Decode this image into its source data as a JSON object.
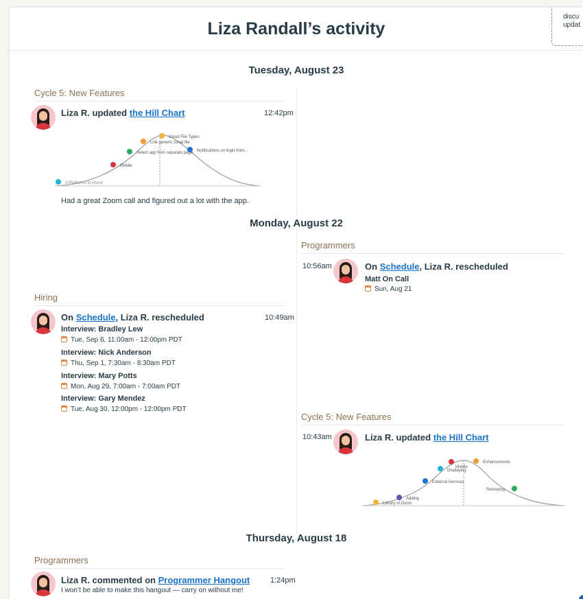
{
  "header": {
    "title": "Liza Randall’s activity"
  },
  "tooltip": {
    "line1": "discu",
    "line2": "updat"
  },
  "days": [
    {
      "label": "Tuesday, August 23"
    },
    {
      "label": "Monday, August 22"
    },
    {
      "label": "Thursday, August 18"
    }
  ],
  "entries": {
    "hill1": {
      "bucket": "Cycle 5: New Features",
      "actor": "Liza R. updated",
      "link": "the Hill Chart",
      "time": "12:42pm",
      "note": "Had a great Zoom call and figured out a lot with the app.",
      "points": [
        {
          "label": "Cloud File Types",
          "color": "#f2b33d"
        },
        {
          "label": "Link generic cloud file",
          "color": "#f29b3a"
        },
        {
          "label": "Select app from separate page",
          "color": "#2aa85b"
        },
        {
          "label": "Notifications on login from...",
          "color": "#1f72d1"
        },
        {
          "label": "Mobile",
          "color": "#d8353b"
        },
        {
          "label": "A Platforms to check",
          "color": "#1fb5d6"
        }
      ]
    },
    "sched1": {
      "bucket": "Programmers",
      "prefix": "On",
      "link": "Schedule",
      "suffix": ", Liza R. rescheduled",
      "time": "10:56am",
      "events": [
        {
          "name": "Matt On Call",
          "when": "Sun, Aug 21"
        }
      ]
    },
    "sched2": {
      "bucket": "Hiring",
      "prefix": "On",
      "link": "Schedule",
      "suffix": ", Liza R. rescheduled",
      "time": "10:49am",
      "events": [
        {
          "name": "Interview: Bradley Lew",
          "when": "Tue, Sep 6, 11:00am - 12:00pm PDT"
        },
        {
          "name": "Interview: Nick Anderson",
          "when": "Thu, Sep 1, 7:30am - 8:30am PDT"
        },
        {
          "name": "Interview: Mary Potts",
          "when": "Mon, Aug 29, 7:00am - 7:00am PDT"
        },
        {
          "name": "Interview: Gary Mendez",
          "when": "Tue, Aug 30, 12:00pm - 12:00pm PDT"
        }
      ]
    },
    "hill2": {
      "bucket": "Cycle 5: New Features",
      "actor": "Liza R. updated",
      "link": "the Hill Chart",
      "time": "10:43am",
      "points": [
        {
          "label": "Enhancements",
          "color": "#f29b3a"
        },
        {
          "label": "Mobile",
          "color": "#d8353b"
        },
        {
          "label": "Displaying",
          "color": "#1fb5d6"
        },
        {
          "label": "External Services",
          "color": "#1f72d1"
        },
        {
          "label": "Removing",
          "color": "#2aa85b"
        },
        {
          "label": "Adding",
          "color": "#6b4fa8"
        },
        {
          "label": "Library of Doors",
          "color": "#f2b33d"
        }
      ]
    },
    "comment1": {
      "bucket": "Programmers",
      "actor": "Liza R. commented on",
      "link": "Programmer Hangout",
      "time": "1:24pm",
      "text": "I won’t be able to make this hangout — carry on without me!"
    }
  }
}
